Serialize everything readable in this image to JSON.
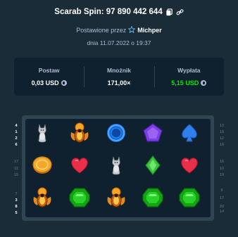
{
  "header": {
    "title": "Scarab Spin: 97 890 442 644",
    "placed_by_label": "Postawione przez",
    "username": "Michper",
    "date": "dnia 11.07.2022 o 19:37"
  },
  "stats": {
    "bet_label": "Postaw",
    "bet_value": "0,03 USD",
    "multiplier_label": "Mnożnik",
    "multiplier_value": "171,00×",
    "payout_label": "Wypłata",
    "payout_value": "5,15 USD"
  },
  "colors": {
    "payout_green": "#00e701",
    "background": "#1a2c38",
    "panel": "#0f212e"
  },
  "reels": {
    "rows": [
      [
        "cat-statue",
        "scarab",
        "blue-ring",
        "purple-pentagon",
        "blue-spade"
      ],
      [
        "gold-coin",
        "red-heart",
        "cat-statue",
        "green-diamond",
        "red-heart"
      ],
      [
        "scarab",
        "green-gem",
        "scarab",
        "green-gem",
        "green-gem"
      ]
    ]
  },
  "paylines": {
    "left": [
      {
        "label": "4",
        "active": true
      },
      {
        "label": "1",
        "active": true
      },
      {
        "label": "2",
        "active": true
      },
      {
        "label": "6",
        "active": true
      },
      {
        "label": "17",
        "active": false
      },
      {
        "label": "11",
        "active": false
      },
      {
        "label": "15",
        "active": false
      },
      {
        "label": "7",
        "active": false
      },
      {
        "label": "3",
        "active": true
      },
      {
        "label": "8",
        "active": true
      },
      {
        "label": "5",
        "active": true
      }
    ],
    "right": [
      {
        "label": "13",
        "active": false
      },
      {
        "label": "15",
        "active": false
      },
      {
        "label": "12",
        "active": false
      },
      {
        "label": "18",
        "active": false
      },
      {
        "label": "16",
        "active": false
      },
      {
        "label": "10",
        "active": false
      },
      {
        "label": "19",
        "active": false
      },
      {
        "label": "9",
        "active": false
      },
      {
        "label": "17",
        "active": false
      },
      {
        "label": "20",
        "active": false
      },
      {
        "label": "14",
        "active": false
      }
    ]
  }
}
